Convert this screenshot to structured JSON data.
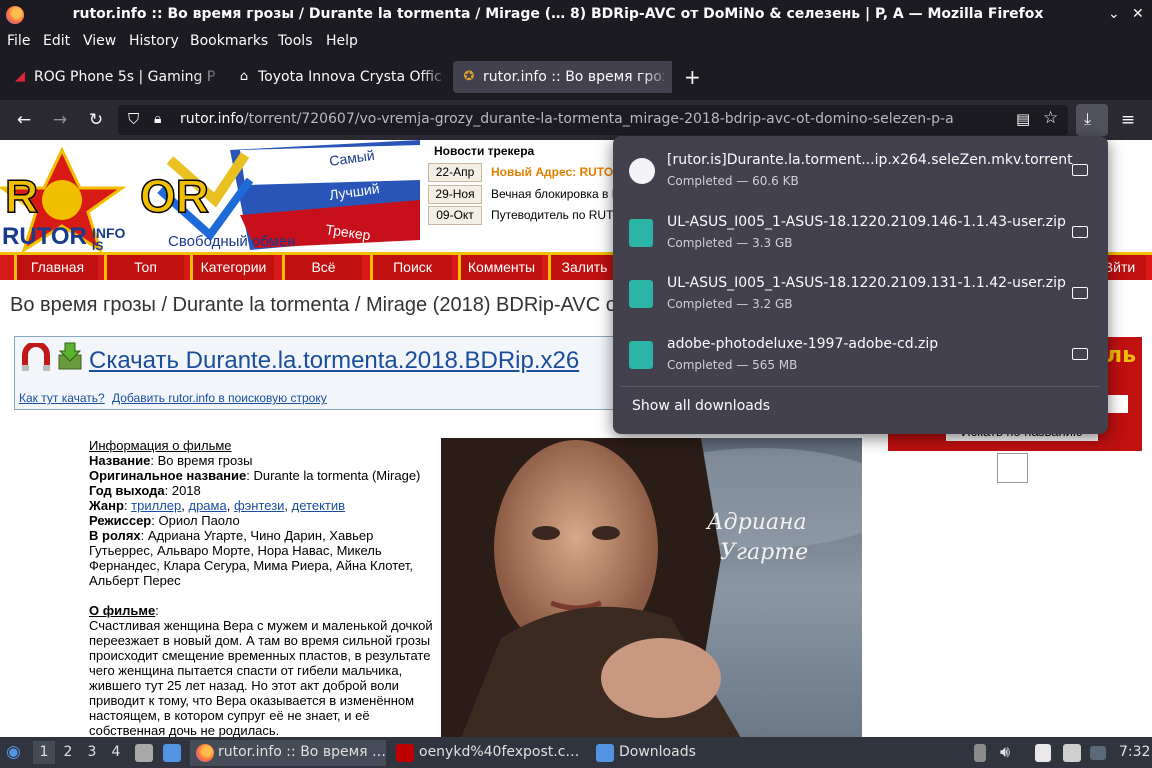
{
  "window": {
    "title": "rutor.info :: Во время грозы / Durante la tormenta / Mirage (… 8) BDRip-AVC от DoMiNo & селезень | P, A — Mozilla Firefox",
    "minimize": "⌄",
    "close": "✕"
  },
  "menubar": [
    "File",
    "Edit",
    "View",
    "History",
    "Bookmarks",
    "Tools",
    "Help"
  ],
  "tabs": [
    {
      "label": "ROG Phone 5s | Gaming Ph",
      "icon": "rog-icon",
      "active": false
    },
    {
      "label": "Toyota Innova Crysta Offic",
      "icon": "wikipedia-icon",
      "active": false
    },
    {
      "label": "rutor.info :: Во время грозы",
      "icon": "rutor-icon",
      "active": true
    }
  ],
  "navbar": {
    "url_host": "rutor.info",
    "url_path": "/torrent/720607/vo-vremja-grozy_durante-la-tormenta_mirage-2018-bdrip-avc-ot-domino-selezen-p-a"
  },
  "page": {
    "logo": {
      "text_rutor": "RUTOR",
      "text_info": "INFO",
      "text_is": "IS",
      "slogan": "Свободный обмен",
      "flag_words": [
        "Самый",
        "Лучший",
        "Трекер"
      ]
    },
    "news_header": "Новости трекера",
    "news": [
      {
        "date": "22-Апр",
        "text": "Новый Адрес: RUTOR",
        "color": "#e08000",
        "bold": true
      },
      {
        "date": "29-Ноя",
        "text": "Вечная блокировка в Р",
        "color": "#000000",
        "bold": false
      },
      {
        "date": "09-Окт",
        "text": "Путеводитель по RUTO",
        "color": "#000000",
        "bold": false
      }
    ],
    "menu": [
      "Главная",
      "Топ",
      "Категории",
      "Всё",
      "Поиск",
      "Комменты",
      "Залить",
      "Вйти"
    ],
    "title": "Во время грозы / Durante la tormenta / Mirage (2018) BDRip-AVC о",
    "download_link": "Скачать Durante.la.tormenta.2018.BDRip.x26",
    "how_to": "Как тут качать?",
    "add_search": "Добавить rutor.info в поисковую строку",
    "info": {
      "header": "Информация о фильме",
      "name_label": "Название",
      "name_value": ": Во время грозы",
      "orig_label": "Оригинальное название",
      "orig_value": ": Durante la tormenta (Mirage)",
      "year_label": "Год выхода",
      "year_value": ": 2018",
      "genre_label": "Жанр",
      "genres": [
        "триллер",
        "драма",
        "фэнтези",
        "детектив"
      ],
      "director_label": "Режиссер",
      "director_value": ": Ориол Паоло",
      "cast_label": "В ролях",
      "cast_value": ": Адриана Угарте, Чино Дарин, Хавьер Гутьеррес, Альваро Морте, Нора Навас, Микель Фернандес, Клара Сегура, Мима Риера, Айна Клотет, Альберт Перес",
      "about_label": "О фильме",
      "about_text": "Счастливая женщина Вера с мужем и маленькой дочкой переезжает в новый дом. А там во время сильной грозы происходит смещение временных пластов, в результате чего женщина пытается спасти от гибели мальчика, жившего тут 25 лет назад. Но этот акт доброй воли приводит к тому, что Вера оказывается в изменённом настоящем, в котором супруг её не знает, и её собственная дочь не родилась."
    },
    "poster_text": [
      "Адриана",
      "Угарте"
    ],
    "right": {
      "button_text": "ль",
      "search_text": "Искать по названию"
    }
  },
  "downloads": {
    "items": [
      {
        "name": "[rutor.is]Durante.la.torment...ip.x264.seleZen.mkv.torrent",
        "status": "Completed — 60.6 KB",
        "type": "torrent"
      },
      {
        "name": "UL-ASUS_I005_1-ASUS-18.1220.2109.146-1.1.43-user.zip",
        "status": "Completed — 3.3 GB",
        "type": "zip"
      },
      {
        "name": "UL-ASUS_I005_1-ASUS-18.1220.2109.131-1.1.42-user.zip",
        "status": "Completed — 3.2 GB",
        "type": "zip"
      },
      {
        "name": "adobe-photodeluxe-1997-adobe-cd.zip",
        "status": "Completed — 565 MB",
        "type": "zip"
      }
    ],
    "show_all": "Show all downloads"
  },
  "taskbar": {
    "workspaces": [
      "1",
      "2",
      "3",
      "4"
    ],
    "apps": [
      {
        "label": "rutor.info :: Во время …",
        "icon": "firefox-icon"
      },
      {
        "label": "oenykd%40fexpost.c…",
        "icon": "filezilla-icon"
      },
      {
        "label": "Downloads",
        "icon": "folder-icon"
      }
    ],
    "clock": "7:32"
  }
}
